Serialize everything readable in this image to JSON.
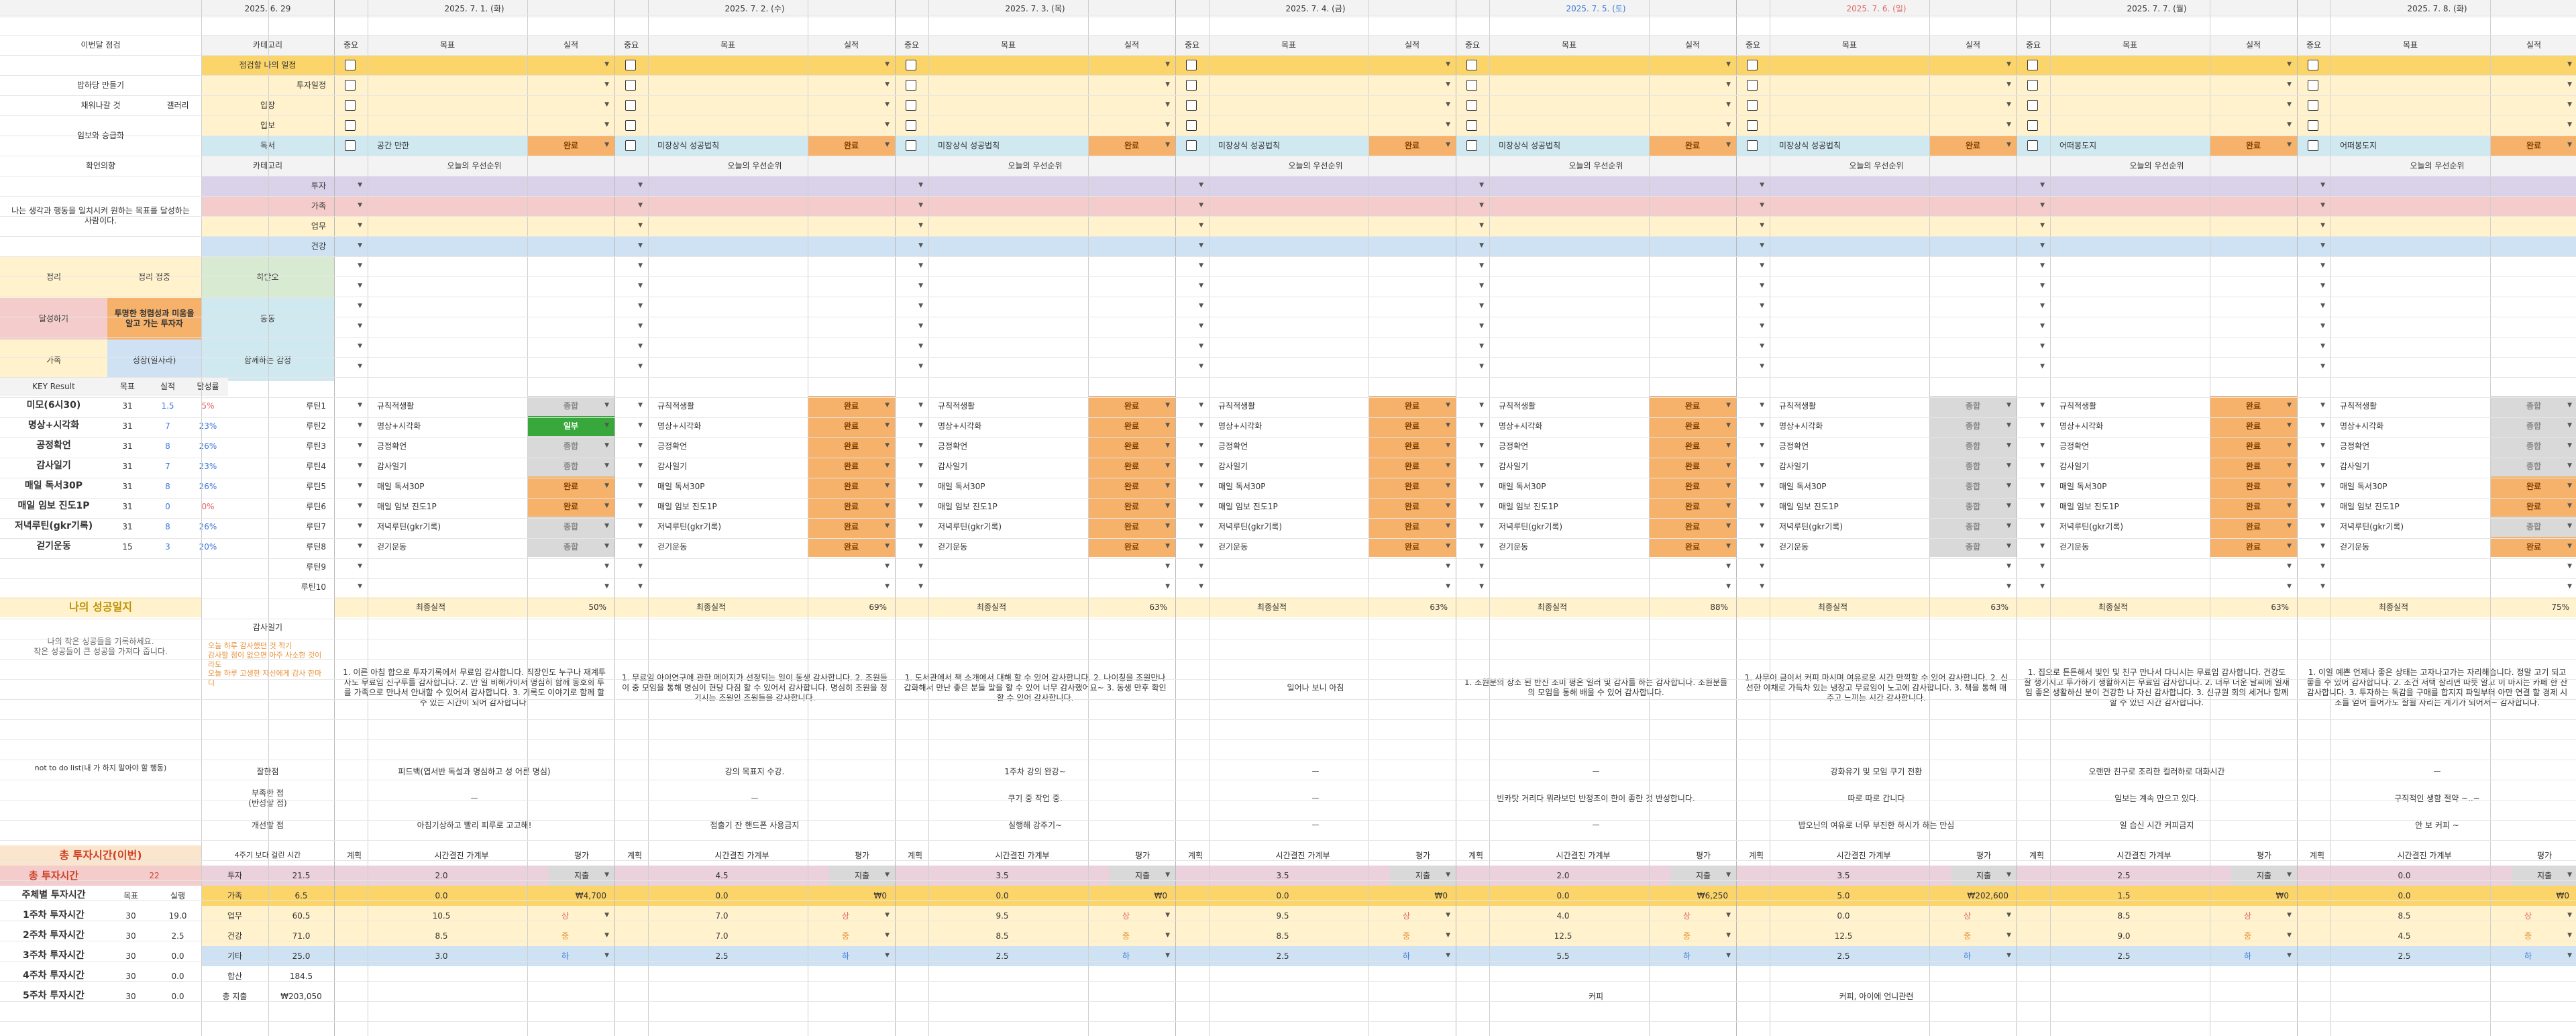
{
  "colors": {
    "header_bg": "#f3f3f3",
    "gold": "#fbd46a",
    "yellow": "#fff2cc",
    "purple": "#d9d2e9",
    "pink": "#f4cccc",
    "green": "#d9ead3",
    "blue": "#cfe2f3",
    "cyan": "#d0e9f0",
    "orange_badge": "#f6b26b",
    "gray_badge": "#d9d9d9",
    "done_green": "#38a83c",
    "red_text": "#e06666",
    "blue_text": "#3c78d8",
    "orange_text": "#e69138",
    "gold_text": "#bf9000"
  },
  "top": {
    "week_start": "2025. 6. 29",
    "days": [
      {
        "date": "2025. 7. 1. (화)",
        "color": "#333"
      },
      {
        "date": "2025. 7. 2. (수)",
        "color": "#333"
      },
      {
        "date": "2025. 7. 3. (목)",
        "color": "#333"
      },
      {
        "date": "2025. 7. 4. (금)",
        "color": "#333"
      },
      {
        "date": "2025. 7. 5. (토)",
        "color": "#3c78d8"
      },
      {
        "date": "2025. 7. 6. (일)",
        "color": "#e06666"
      },
      {
        "date": "2025. 7. 7. (월)",
        "color": "#333"
      },
      {
        "date": "2025. 7. 8. (화)",
        "color": "#333"
      }
    ]
  },
  "col_headers": {
    "category": "카테고리",
    "important": "중요",
    "goal": "목표",
    "result": "실적"
  },
  "section_top": {
    "left_rows": [
      "이번달 점검",
      "밥하당 만들기",
      "채워나갈 것",
      "임보와 승급화"
    ],
    "category_items": [
      "점검할 나의 일정",
      "투자일정",
      "입장",
      "입보",
      "독서"
    ],
    "group_label": "갤러리",
    "reading_goals": [
      "공간 만한",
      "미장상식 성공법칙",
      "미장상식 성공법칙",
      "미장상식 성공법칙",
      "미장상식 성공법칙",
      "미장상식 성공법칙",
      "어떠봉도지",
      "어떠봉도지"
    ]
  },
  "top_status": {
    "done": "완료",
    "priority": "오늘의 우선순위"
  },
  "section_mid": {
    "title": "확언의향",
    "cat_header": "카테고리",
    "desc": "나는 생각과 행동을 일치시켜 원하는 목표를 달성하는 사람이다.",
    "cats": [
      "투자",
      "가족",
      "업무",
      "건강"
    ],
    "grid": [
      [
        "정리",
        "정리 정중",
        "하단오"
      ],
      [
        "달성하기",
        "투명한 청렴성과 미움을 알고 가는 투자자",
        "동동"
      ],
      [
        "가족",
        "성장(일자라)",
        "함께하는 감정"
      ]
    ]
  },
  "kr": {
    "headers": [
      "KEY Result",
      "목표",
      "실적",
      "달성률"
    ],
    "rows": [
      {
        "name": "미모(6시30)",
        "goal": "31",
        "done": "1.5",
        "rate": "5%",
        "rate_color": "#e06666"
      },
      {
        "name": "명상+시각화",
        "goal": "31",
        "done": "7",
        "rate": "23%",
        "rate_color": "#3c78d8"
      },
      {
        "name": "공정확언",
        "goal": "31",
        "done": "8",
        "rate": "26%",
        "rate_color": "#3c78d8"
      },
      {
        "name": "감사일기",
        "goal": "31",
        "done": "7",
        "rate": "23%",
        "rate_color": "#3c78d8"
      },
      {
        "name": "매일 독서30P",
        "goal": "31",
        "done": "8",
        "rate": "26%",
        "rate_color": "#3c78d8"
      },
      {
        "name": "매일 임보 진도1P",
        "goal": "31",
        "done": "0",
        "rate": "0%",
        "rate_color": "#e06666"
      },
      {
        "name": "저녁루틴(gkr기록)",
        "goal": "31",
        "done": "8",
        "rate": "26%",
        "rate_color": "#3c78d8"
      },
      {
        "name": "걷기운동",
        "goal": "15",
        "done": "3",
        "rate": "20%",
        "rate_color": "#3c78d8"
      }
    ],
    "routines": [
      "루틴1",
      "루틴2",
      "루틴3",
      "루틴4",
      "루틴5",
      "루틴6",
      "루틴7",
      "루틴8",
      "루틴9",
      "루틴10"
    ],
    "day_items": [
      "규칙적생활",
      "명상+시각화",
      "긍정확언",
      "감사일기",
      "매일 독서30P",
      "매일 임보 진도1P",
      "저녁루틴(gkr기록)",
      "걷기운동"
    ],
    "statuses": [
      [
        "종합",
        "완료",
        "완료",
        "완료",
        "완료",
        "종합",
        "완료",
        "종합"
      ],
      [
        "일부",
        "완료",
        "완료",
        "완료",
        "완료",
        "종합",
        "완료",
        "종합"
      ],
      [
        "종합",
        "완료",
        "완료",
        "완료",
        "완료",
        "종합",
        "완료",
        "종합"
      ],
      [
        "종합",
        "완료",
        "완료",
        "완료",
        "완료",
        "종합",
        "완료",
        "종합"
      ],
      [
        "완료",
        "완료",
        "완료",
        "완료",
        "완료",
        "종합",
        "완료",
        "완료"
      ],
      [
        "완료",
        "완료",
        "완료",
        "완료",
        "완료",
        "종합",
        "완료",
        "완료"
      ],
      [
        "종합",
        "완료",
        "완료",
        "완료",
        "완료",
        "종합",
        "완료",
        "종합"
      ],
      [
        "종합",
        "완료",
        "완료",
        "완료",
        "완료",
        "종합",
        "완료",
        "완료"
      ]
    ],
    "final_label": "최종실적",
    "final_pcts": [
      "50%",
      "69%",
      "63%",
      "63%",
      "88%",
      "63%",
      "63%",
      "75%"
    ]
  },
  "journal": {
    "title": "나의 성공일지",
    "subtitle": "나의 작은 성공들을 기록하세요.\n작은 성공들이 큰 성공을 가져다 줍니다.",
    "gratitude": "감사일기",
    "hint": "오늘 하루 감사했던 것 적기\n감사할 점이 없으면 아주 사소한 것이라도\n오늘 하루 고생한 자신에게 감사 한마디",
    "not_todo": "not to do list(내 가 하지 말아야 할 행동)",
    "rows": [
      "잘한점",
      "부족한 점\n(반성할 점)",
      "개선할 점"
    ],
    "entries": [
      "1. 이른 아침 합으로 투자기록에서 무료임 감사합니다.\n직장인도 누구나 재계투자도 무료임 진구투를 감사합니다. 2. 만 일 비해가이서 명심히 함께 동호회 투를 가족으로 만나서 안내할 수 있어서 감사합니다. 3. 기록도 이야기로 함께 할 수 있는 시간이 되어 감사합니다.",
      "1. 무료임 아이연구에 관한 메이지가 선정되는 일이 동생 감사합니다. 2. 조원들이 중 모임을 통해 명심이 현당 다짐 할 수 있어서 감사합니다. 명심히 조원을 정기시는 조원인 조원들을 감사합니다.",
      "1. 도서관에서 책 소개에서 대해 할 수 있어 감사합니다. 2. 나이칭을 조원만나 갑화해서 만난 좋은 분들 말을 할 수 있어 너무 감사했어요~ 3. 동생 만후 확인할 수 있어 감사합니다.",
      "일어나 보니 아침",
      "1. 조원분의 상소 된 반신 조미 평온 일러 및 감사를 하는 감사합니다. 조원분들의 모임을 통해 배울 수 있어 감사합니다.",
      "1. 사무이 금이서 커피 마시며 여유로운 시간 만끽할 수 있어 감사합니다. 2. 신선한 야채로 가득차 있는 냉장고 무료임이 노고에 감사합니다. 3. 책을 통해 매주고 느끼는 시간 감사합니다.",
      "1. 집으로 튼튼해서 빛인 및 친구 만나서 다니시는 무료임 감사합니다. 건강도 잘 챙기시고 투가하기 생활하시는 무료임 감사합니다. 2. 너무 더운 날씨에 일새임 좋은 생활하신 분이 건강한 나 자신 감사합니다. 3. 신규원 회의 세거나 함께 할 수 있던 시간 감사합니다.",
      "1. 이일 예쁜 언제나 좋은 상태는 고자나고가는 자리해습니다. 정말 고기 되고 좋을 수 있어 감사합니다. 2. 조건 저택 살리면 따뜻 알고 이 마시는 카페 한 잔 감사합니다. 3. 투자하는 독감을 구매를 합지지 파일부터 아만 연결 할 경제 시조를 얻어 들어가도 잘될 자리는 계기가 되어서~ 감사합니다."
    ],
    "good": [
      "피드백(엽서반 독설과 명심하고 성 어른 명심)",
      "강의 목표지 수강.",
      "1주차 강의 완강~",
      "ㅡ",
      "ㅡ",
      "강화유기 및 모임 쿠기 전환",
      "오랜만 친구로 조리한 컬러하로 대화시간",
      "ㅡ"
    ],
    "bad": [
      "ㅡ",
      "ㅡ",
      "쿠기 중 작업 중.",
      "ㅡ",
      "빈카탓 거리다 뭐라보던 반정조이 한이 좋한 것 반성합니다.",
      "따로 따로 갑니다",
      "임보는 계속 만으고 있다.",
      "구직적인 생함 절약 ~..~"
    ],
    "improve": [
      "아침기상하고 빨리 피루로 고고해!",
      "점출기 잔 핸드폰 사용금지",
      "실행해 강주기~",
      "ㅡ",
      "ㅡ",
      "밥오닌의 여유로 너무 부진한 하시가 하는 만심",
      "일 습신 시간 커피금지",
      "안 보 커피 ~"
    ]
  },
  "invest": {
    "title": "총 투자시간(이번)",
    "total_label": "총 투자시간",
    "total_value": "22",
    "left_headers": [
      "",
      "목표",
      "실행"
    ],
    "weeks": [
      {
        "name": "주체별 투자시간",
        "goal": "목표",
        "done": "실행"
      },
      {
        "name": "1주차 투자시간",
        "goal": "30",
        "done": "19.0"
      },
      {
        "name": "2주차 투자시간",
        "goal": "30",
        "done": "2.5"
      },
      {
        "name": "3주차 투자시간",
        "goal": "30",
        "done": "0.0"
      },
      {
        "name": "4주차 투자시간",
        "goal": "30",
        "done": "0.0"
      },
      {
        "name": "5주차 투자시간",
        "goal": "30",
        "done": "0.0"
      }
    ],
    "sum_header": "4주기 보다 걸린 시간",
    "cats": [
      {
        "name": "투자",
        "value": "21.5"
      },
      {
        "name": "가족",
        "value": "6.5"
      },
      {
        "name": "업무",
        "value": "60.5"
      },
      {
        "name": "건강",
        "value": "71.0"
      },
      {
        "name": "기타",
        "value": "25.0"
      },
      {
        "name": "합산",
        "value": "184.5"
      },
      {
        "name": "총 지출",
        "value": "₩203,050"
      }
    ],
    "day_headers": [
      "계획",
      "시간결진 가계부",
      "평가"
    ],
    "days": [
      {
        "plan": [
          "2.0",
          "0.0",
          "10.5",
          "8.5",
          "3.0"
        ],
        "ledger": "₩4,700",
        "grade": [
          "지출",
          "",
          "상",
          "중",
          "하"
        ]
      },
      {
        "plan": [
          "4.5",
          "0.0",
          "7.0",
          "7.0",
          "2.5"
        ],
        "ledger": "₩0",
        "grade": [
          "지출",
          "",
          "상",
          "중",
          "하"
        ]
      },
      {
        "plan": [
          "3.5",
          "0.0",
          "9.5",
          "8.5",
          "2.5"
        ],
        "ledger": "₩0",
        "grade": [
          "지출",
          "",
          "상",
          "중",
          "하"
        ]
      },
      {
        "plan": [
          "3.5",
          "0.0",
          "9.5",
          "8.5",
          "2.5"
        ],
        "ledger": "₩0",
        "grade": [
          "지출",
          "",
          "상",
          "중",
          "하"
        ]
      },
      {
        "plan": [
          "2.0",
          "0.0",
          "4.0",
          "12.5",
          "5.5"
        ],
        "ledger": "₩6,250",
        "grade": [
          "지출",
          "",
          "상",
          "중",
          "하"
        ]
      },
      {
        "plan": [
          "3.5",
          "5.0",
          "0.0",
          "12.5",
          "2.5"
        ],
        "ledger": "₩202,600",
        "grade": [
          "지출",
          "",
          "상",
          "중",
          "하"
        ]
      },
      {
        "plan": [
          "2.5",
          "1.5",
          "8.5",
          "9.0",
          "2.5"
        ],
        "ledger": "₩0",
        "grade": [
          "지출",
          "",
          "상",
          "중",
          "하"
        ]
      },
      {
        "plan": [
          "0.0",
          "0.0",
          "8.5",
          "4.5",
          "2.5"
        ],
        "ledger": "₩0",
        "grade": [
          "지출",
          "",
          "상",
          "중",
          "하"
        ]
      }
    ],
    "notes": [
      "",
      "",
      "",
      "",
      "커피",
      "커피, 아이에 언니관련",
      "",
      ""
    ]
  }
}
